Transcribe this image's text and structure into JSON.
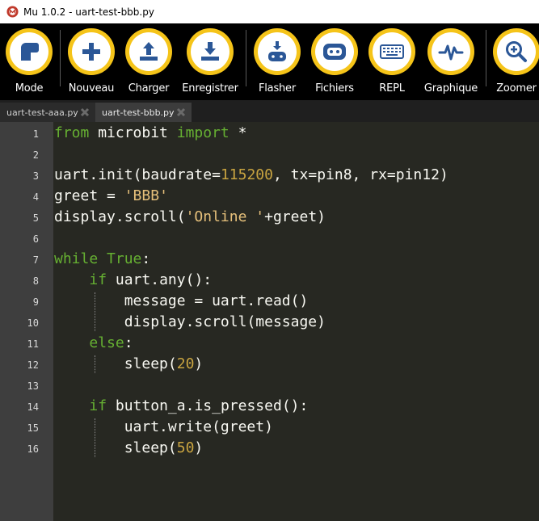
{
  "window": {
    "title": "Mu 1.0.2 - uart-test-bbb.py"
  },
  "toolbar": {
    "buttons": [
      {
        "label": "Mode",
        "icon": "mode-icon"
      },
      {
        "label": "Nouveau",
        "icon": "plus-icon"
      },
      {
        "label": "Charger",
        "icon": "upload-icon"
      },
      {
        "label": "Enregistrer",
        "icon": "download-icon"
      },
      {
        "label": "Flasher",
        "icon": "flash-microbit-icon"
      },
      {
        "label": "Fichiers",
        "icon": "files-icon"
      },
      {
        "label": "REPL",
        "icon": "keyboard-icon"
      },
      {
        "label": "Graphique",
        "icon": "plotter-icon"
      },
      {
        "label": "Zoomer",
        "icon": "zoom-in-icon"
      }
    ]
  },
  "tabs": [
    {
      "label": "uart-test-aaa.py",
      "active": false
    },
    {
      "label": "uart-test-bbb.py",
      "active": true
    }
  ],
  "editor": {
    "line_numbers": [
      "1",
      "2",
      "3",
      "4",
      "5",
      "6",
      "7",
      "8",
      "9",
      "10",
      "11",
      "12",
      "13",
      "14",
      "15",
      "16"
    ],
    "lines": [
      "from microbit import *",
      "",
      "uart.init(baudrate=115200, tx=pin8, rx=pin12)",
      "greet = 'BBB'",
      "display.scroll('Online '+greet)",
      "",
      "while True:",
      "    if uart.any():",
      "        message = uart.read()",
      "        display.scroll(message)",
      "    else:",
      "        sleep(20)",
      "",
      "    if button_a.is_pressed():",
      "        uart.write(greet)",
      "        sleep(50)"
    ]
  },
  "colors": {
    "toolbar_bg": "#000000",
    "button_ring": "#f5c419",
    "icon_fg": "#2b5797",
    "editor_bg": "#272822",
    "gutter_bg": "#3e3e3e",
    "keyword": "#66b032",
    "number": "#c9a440"
  }
}
